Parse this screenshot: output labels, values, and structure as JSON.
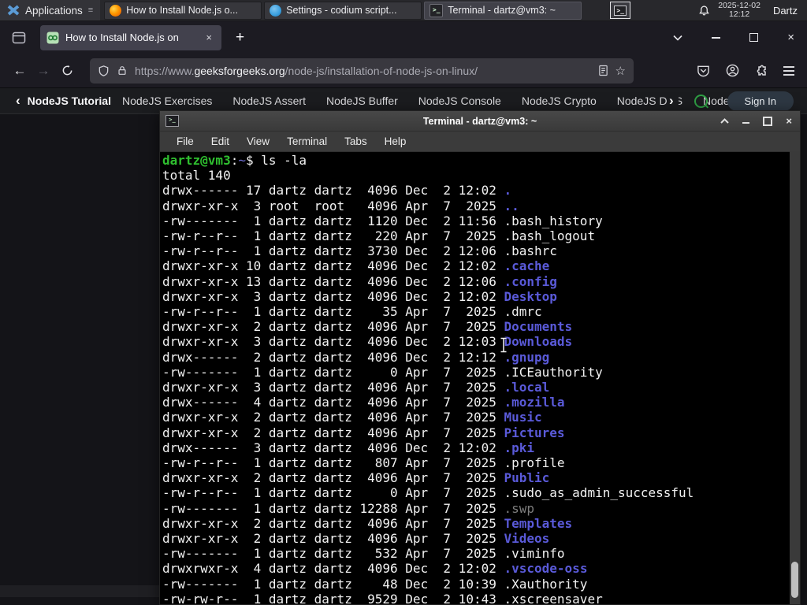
{
  "panel": {
    "applications_label": "Applications",
    "tasks": [
      {
        "label": "How to Install Node.js o...",
        "icon": "firefox",
        "active": false
      },
      {
        "label": "Settings - codium script...",
        "icon": "codium",
        "active": false
      },
      {
        "label": "Terminal - dartz@vm3: ~",
        "icon": "terminal",
        "active": true
      }
    ],
    "clock_date": "2025-12-02",
    "clock_time": "12:12",
    "user_label": "Dartz"
  },
  "browser": {
    "tab": {
      "title": "How to Install Node.js on"
    },
    "url": {
      "prefix": "https://www.",
      "domain": "geeksforgeeks.org",
      "path": "/node-js/installation-of-node-js-on-linux/"
    },
    "nav": {
      "back_item": "NodeJS Tutorial",
      "items": [
        "NodeJS Exercises",
        "NodeJS Assert",
        "NodeJS Buffer",
        "NodeJS Console",
        "NodeJS Crypto",
        "NodeJS DNS",
        "Node"
      ],
      "sign_in_label": "Sign In"
    }
  },
  "terminal_window": {
    "title": "Terminal - dartz@vm3: ~",
    "menu_items": [
      "File",
      "Edit",
      "View",
      "Terminal",
      "Tabs",
      "Help"
    ],
    "lines": [
      [
        [
          "dartz@vm3",
          "p"
        ],
        [
          ":",
          "f"
        ],
        [
          "~",
          "t"
        ],
        [
          "$ ls -la",
          "f"
        ]
      ],
      [
        [
          "total 140",
          "f"
        ]
      ],
      [
        [
          "drwx------ 17 dartz dartz  4096 Dec  2 12:02 ",
          "f"
        ],
        [
          ".",
          "d"
        ]
      ],
      [
        [
          "drwxr-xr-x  3 root  root   4096 Apr  7  2025 ",
          "f"
        ],
        [
          "..",
          "d"
        ]
      ],
      [
        [
          "-rw-------  1 dartz dartz  1120 Dec  2 11:56 .bash_history",
          "f"
        ]
      ],
      [
        [
          "-rw-r--r--  1 dartz dartz   220 Apr  7  2025 .bash_logout",
          "f"
        ]
      ],
      [
        [
          "-rw-r--r--  1 dartz dartz  3730 Dec  2 12:06 .bashrc",
          "f"
        ]
      ],
      [
        [
          "drwxr-xr-x 10 dartz dartz  4096 Dec  2 12:02 ",
          "f"
        ],
        [
          ".cache",
          "d"
        ]
      ],
      [
        [
          "drwxr-xr-x 13 dartz dartz  4096 Dec  2 12:06 ",
          "f"
        ],
        [
          ".config",
          "d"
        ]
      ],
      [
        [
          "drwxr-xr-x  3 dartz dartz  4096 Dec  2 12:02 ",
          "f"
        ],
        [
          "Desktop",
          "d"
        ]
      ],
      [
        [
          "-rw-r--r--  1 dartz dartz    35 Apr  7  2025 .dmrc",
          "f"
        ]
      ],
      [
        [
          "drwxr-xr-x  2 dartz dartz  4096 Apr  7  2025 ",
          "f"
        ],
        [
          "Documents",
          "d"
        ]
      ],
      [
        [
          "drwxr-xr-x  3 dartz dartz  4096 Dec  2 12:03 ",
          "f"
        ],
        [
          "Downloads",
          "d"
        ]
      ],
      [
        [
          "drwx------  2 dartz dartz  4096 Dec  2 12:12 ",
          "f"
        ],
        [
          ".gnupg",
          "d"
        ]
      ],
      [
        [
          "-rw-------  1 dartz dartz     0 Apr  7  2025 .ICEauthority",
          "f"
        ]
      ],
      [
        [
          "drwxr-xr-x  3 dartz dartz  4096 Apr  7  2025 ",
          "f"
        ],
        [
          ".local",
          "d"
        ]
      ],
      [
        [
          "drwx------  4 dartz dartz  4096 Apr  7  2025 ",
          "f"
        ],
        [
          ".mozilla",
          "d"
        ]
      ],
      [
        [
          "drwxr-xr-x  2 dartz dartz  4096 Apr  7  2025 ",
          "f"
        ],
        [
          "Music",
          "d"
        ]
      ],
      [
        [
          "drwxr-xr-x  2 dartz dartz  4096 Apr  7  2025 ",
          "f"
        ],
        [
          "Pictures",
          "d"
        ]
      ],
      [
        [
          "drwx------  3 dartz dartz  4096 Dec  2 12:02 ",
          "f"
        ],
        [
          ".pki",
          "d"
        ]
      ],
      [
        [
          "-rw-r--r--  1 dartz dartz   807 Apr  7  2025 .profile",
          "f"
        ]
      ],
      [
        [
          "drwxr-xr-x  2 dartz dartz  4096 Apr  7  2025 ",
          "f"
        ],
        [
          "Public",
          "d"
        ]
      ],
      [
        [
          "-rw-r--r--  1 dartz dartz     0 Apr  7  2025 .sudo_as_admin_successful",
          "f"
        ]
      ],
      [
        [
          "-rw-------  1 dartz dartz 12288 Apr  7  2025 ",
          "f"
        ],
        [
          ".swp",
          "x"
        ]
      ],
      [
        [
          "drwxr-xr-x  2 dartz dartz  4096 Apr  7  2025 ",
          "f"
        ],
        [
          "Templates",
          "d"
        ]
      ],
      [
        [
          "drwxr-xr-x  2 dartz dartz  4096 Apr  7  2025 ",
          "f"
        ],
        [
          "Videos",
          "d"
        ]
      ],
      [
        [
          "-rw-------  1 dartz dartz   532 Apr  7  2025 .viminfo",
          "f"
        ]
      ],
      [
        [
          "drwxrwxr-x  4 dartz dartz  4096 Dec  2 12:02 ",
          "f"
        ],
        [
          ".vscode-oss",
          "d"
        ]
      ],
      [
        [
          "-rw-------  1 dartz dartz    48 Dec  2 10:39 .Xauthority",
          "f"
        ]
      ],
      [
        [
          "-rw-rw-r--  1 dartz dartz  9529 Dec  2 10:43 .xscreensaver",
          "f"
        ]
      ]
    ]
  },
  "icons": {
    "hamburger_lines": "≡",
    "new_tab": "+",
    "close": "×",
    "back_arrow": "←",
    "forward_arrow": "→",
    "star": "☆",
    "back_chevron": "‹",
    "next_chevron": "›",
    "prompt_glyph": ">_"
  },
  "colors": {
    "prompt_green": "#2fbf2f",
    "dir_blue": "#5a5ad9",
    "dim_gray": "#7d7d7d",
    "gfg_green": "#2f9e44",
    "terminal_bg": "#000000",
    "panel_bg": "#28282c",
    "browser_chrome_bg": "#1c1b22"
  }
}
